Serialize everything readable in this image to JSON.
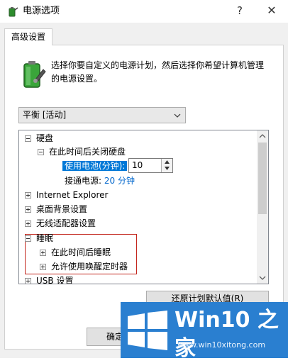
{
  "window": {
    "title": "电源选项",
    "help_label": "?",
    "close_label": "✕"
  },
  "tabs": [
    {
      "label": "高级设置",
      "active": true
    }
  ],
  "description": "选择你要自定义的电源计划，然后选择你希望计算机管理的电源设置。",
  "plan_select": {
    "value": "平衡 [活动]"
  },
  "tree": {
    "hard_disk": {
      "label": "硬盘",
      "child": {
        "label": "在此时间后关闭硬盘",
        "on_battery_label": "使用电池(分钟):",
        "on_battery_value": "10",
        "plugged_in_label": "接通电源:",
        "plugged_in_value": "20 分钟"
      }
    },
    "internet_explorer": "Internet Explorer",
    "desktop_background": "桌面背景设置",
    "wireless_adapter": "无线适配器设置",
    "sleep": {
      "label": "睡眠",
      "children": [
        "在此时间后睡眠",
        "允许使用唤醒定时器"
      ]
    },
    "usb": "USB 设置"
  },
  "buttons": {
    "restore_defaults": "还原计划默认值(R)",
    "ok": "确定"
  },
  "watermark": {
    "title": "Win10 之家",
    "url": "www.win10xitong.com"
  },
  "colors": {
    "selection": "#0078d7",
    "highlight_border": "#c3261d",
    "watermark_bg": "#2a7fd0",
    "link": "#0066cc"
  }
}
